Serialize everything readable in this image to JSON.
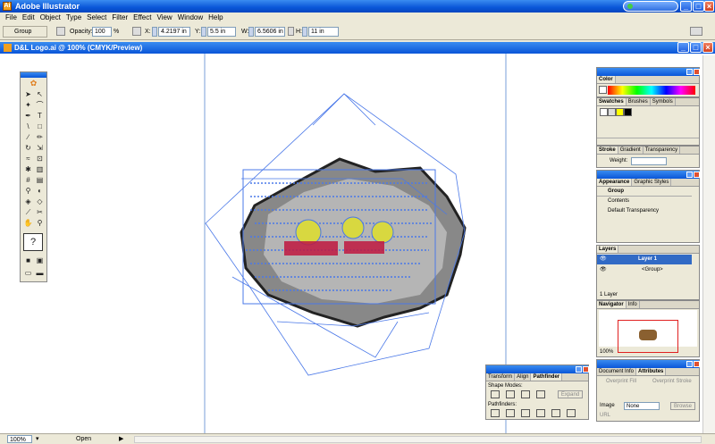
{
  "app": {
    "title": "Adobe Illustrator"
  },
  "menu": [
    "File",
    "Edit",
    "Object",
    "Type",
    "Select",
    "Filter",
    "Effect",
    "View",
    "Window",
    "Help"
  ],
  "control": {
    "selection_type": "Group",
    "opacity_label": "Opacity:",
    "opacity": "100",
    "opacity_unit": "%",
    "x_label": "X:",
    "x": "4.2197 in",
    "y_label": "Y:",
    "y": "5.5 in",
    "w_label": "W:",
    "w": "6.5606 in",
    "h_label": "H:",
    "h": "11 in"
  },
  "document": {
    "title": "D&L Logo.ai @ 100% (CMYK/Preview)"
  },
  "status": {
    "zoom": "100%",
    "info": "Open"
  },
  "color_panel": {
    "tab": "Color"
  },
  "swatches_panel": {
    "tabs": [
      "Swatches",
      "Brushes",
      "Symbols"
    ]
  },
  "stroke_panel": {
    "tabs": [
      "Stroke",
      "Gradient",
      "Transparency"
    ],
    "weight_label": "Weight:"
  },
  "appearance_panel": {
    "tabs": [
      "Appearance",
      "Graphic Styles"
    ],
    "items": [
      "Group",
      "Contents",
      "Default Transparency"
    ]
  },
  "layers_panel": {
    "tab": "Layers",
    "rows": [
      "Layer 1",
      "<Group>"
    ],
    "footer": "1 Layer"
  },
  "navigator_panel": {
    "tabs": [
      "Navigator",
      "Info"
    ],
    "zoom": "100%"
  },
  "pathfinder_panel": {
    "tabs": [
      "Transform",
      "Align",
      "Pathfinder"
    ],
    "shape_modes": "Shape Modes:",
    "pathfinders": "Pathfinders:",
    "expand": "Expand"
  },
  "attributes_panel": {
    "tabs": [
      "Document Info",
      "Attributes"
    ],
    "overprint_fill": "Overprint Fill",
    "overprint_stroke": "Overprint Stroke",
    "image_label": "Image",
    "image_value": "None",
    "browse": "Browse",
    "url_label": "URL"
  },
  "colors": {
    "selection_blue": "#4a78e8",
    "title_blue": "#0a56d8",
    "guide": "#5b8fd8"
  }
}
